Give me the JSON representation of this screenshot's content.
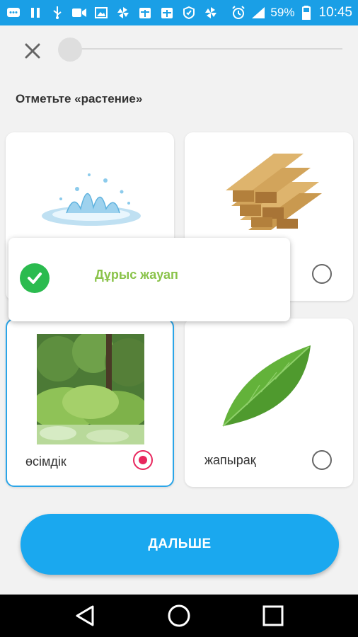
{
  "status_bar": {
    "battery": "59%",
    "time": "10:45",
    "left_icons": [
      "messages-icon",
      "pause-icon",
      "usb-icon",
      "video-icon",
      "image-icon",
      "pinwheel-icon",
      "calendar-icon",
      "calendar-icon",
      "shield-icon",
      "pinwheel-icon"
    ],
    "right_icons": [
      "alarm-icon",
      "signal-icon",
      "battery-icon"
    ]
  },
  "quiz": {
    "progress": 0.0,
    "question": "Отметьте «растение»",
    "options": [
      {
        "label": "",
        "image": "water-splash",
        "selected": false
      },
      {
        "label": "",
        "image": "wood-planks",
        "selected": false
      },
      {
        "label": "өсімдік",
        "image": "plants",
        "selected": true
      },
      {
        "label": "жапырақ",
        "image": "leaf",
        "selected": false
      }
    ]
  },
  "feedback": {
    "text": "Дұрыс жауап",
    "status": "correct",
    "color": "#8ac34a"
  },
  "next_button": {
    "label": "ДАЛЬШЕ"
  },
  "colors": {
    "accent": "#1a9fe6",
    "button": "#1aa8ef",
    "selected_radio": "#e8265d",
    "success": "#2bbb4f"
  }
}
